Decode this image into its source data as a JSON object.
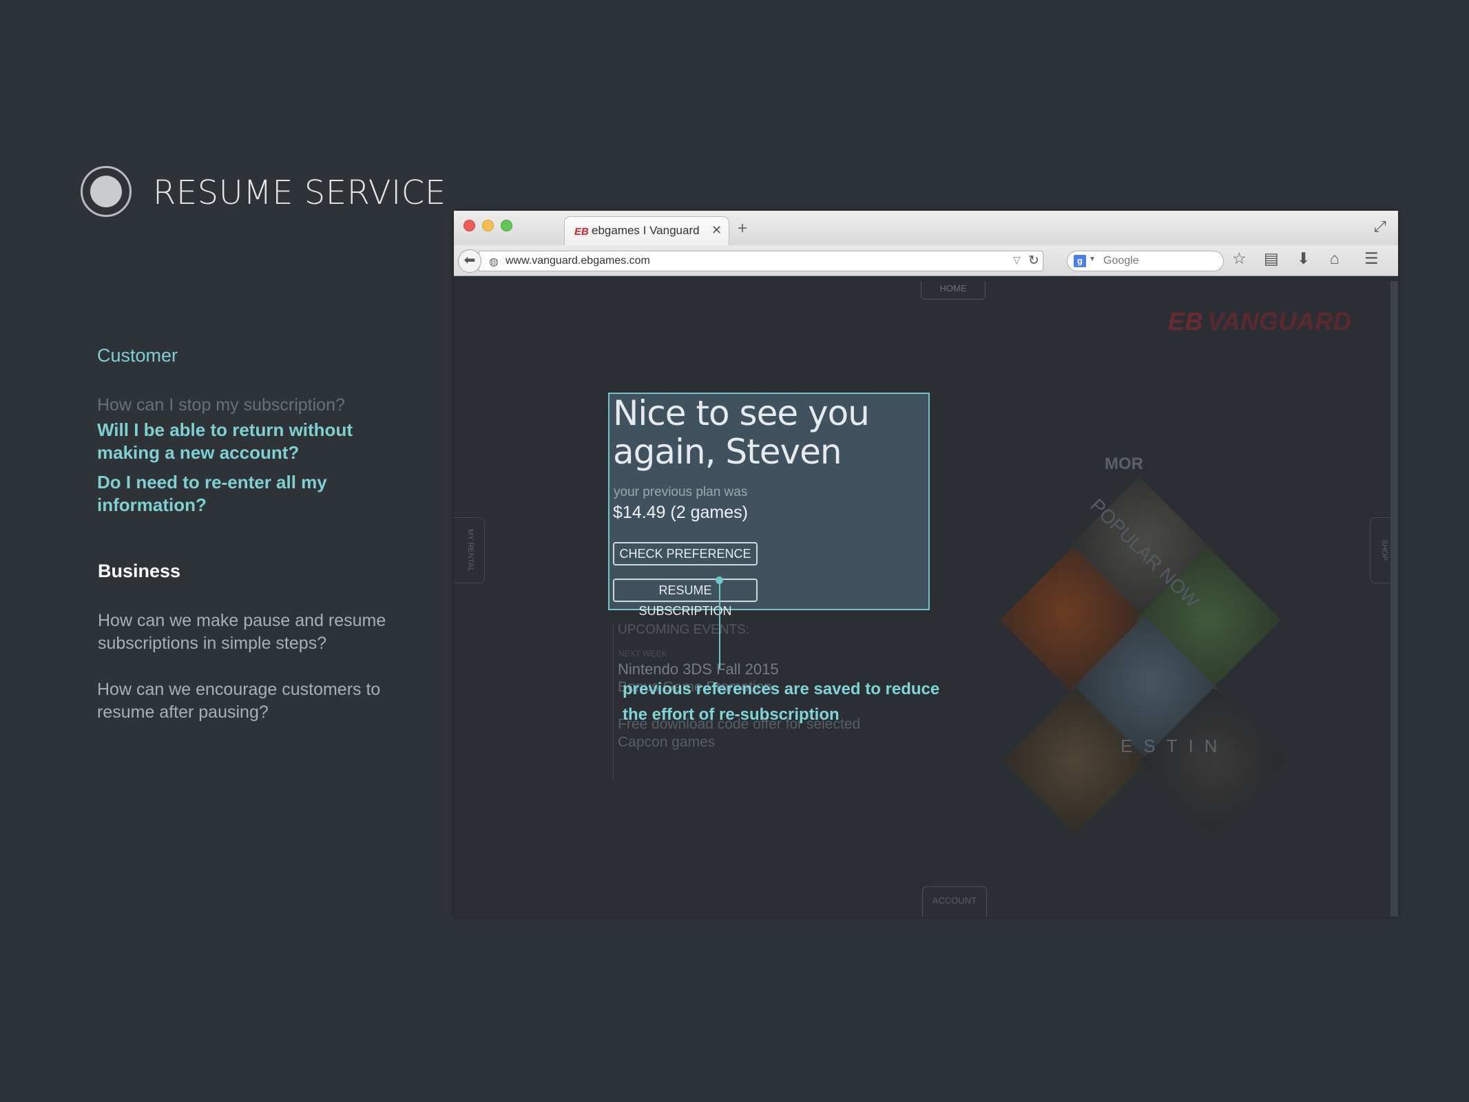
{
  "slide": {
    "title": "RESUME SERVICE",
    "customer": {
      "heading": "Customer",
      "questions": [
        "How can I stop my subscription?",
        "Will I be able to return without making a new account?",
        "Do I need to re-enter all my information?"
      ]
    },
    "business": {
      "heading": "Business",
      "questions": [
        "How can we make pause and resume subscriptions in simple steps?",
        "How can we encourage customers to resume after pausing?"
      ]
    }
  },
  "browser": {
    "tab_title": "ebgames I Vanguard",
    "tab_favicon": "EB",
    "url": "www.vanguard.ebgames.com",
    "search_placeholder": "Google",
    "search_engine_badge": "g"
  },
  "page": {
    "nav_top": "HOME",
    "nav_bottom": "ACCOUNT",
    "side_left": "MY RENTAL",
    "side_right": "SHOP",
    "brand": {
      "mark": "EB",
      "name": "VANGUARD"
    },
    "welcome": {
      "heading": "Nice to see you again, Steven",
      "plan_label": "your previous plan was",
      "plan_value": "$14.49 (2 games)",
      "check_button": "CHECK PREFERENCE",
      "resume_button": "RESUME SUBSCRIPTION"
    },
    "events": {
      "title": "UPCOMING EVENTS:",
      "when": "NEXT WEEK",
      "items": [
        "Nintendo 3DS Fall 2015",
        "Bonus Game Promotion",
        "Free download code offer for selected Capcon games"
      ]
    },
    "popular": {
      "label": "POPULAR NOW",
      "tile_texts": [
        "MOR",
        "ESTIN"
      ]
    },
    "annotation": "previous references are saved to reduce the effort of re-subscription"
  },
  "colors": {
    "background": "#2e3338",
    "accent": "#7fcfd3",
    "card_border": "#6fc7cc",
    "brand_red": "#d8242f"
  },
  "icons": {
    "slide": "radio-circle-icon",
    "back": "back-arrow-icon",
    "site_identity": "globe-icon",
    "reload": "reload-icon",
    "bookmark": "star-icon",
    "reader": "reader-icon",
    "download": "download-icon",
    "home": "home-icon",
    "menu": "hamburger-menu-icon",
    "fullscreen": "fullscreen-icon"
  }
}
